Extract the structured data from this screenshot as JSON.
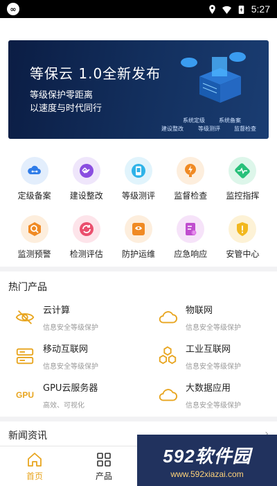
{
  "status_bar": {
    "time": "5:27"
  },
  "banner": {
    "title": "等保云 1.0全新发布",
    "subtitle_1": "等级保护零距离",
    "subtitle_2": "以速度与时代同行",
    "tags": [
      "系统定级",
      "系统备案",
      "建设整改",
      "等级测评",
      "监督检查"
    ]
  },
  "services": [
    {
      "label": "定级备案",
      "icon": "cloud-link-icon",
      "color": "#2f7ce8"
    },
    {
      "label": "建设整改",
      "icon": "link-icon",
      "color": "#8a4ee0"
    },
    {
      "label": "等级测评",
      "icon": "tablet-icon",
      "color": "#2fb3e8"
    },
    {
      "label": "监督检查",
      "icon": "lightning-icon",
      "color": "#f08a24"
    },
    {
      "label": "监控指挥",
      "icon": "pulse-icon",
      "color": "#28c07a"
    },
    {
      "label": "监测预警",
      "icon": "search-alert-icon",
      "color": "#f08a24"
    },
    {
      "label": "检测评估",
      "icon": "refresh-icon",
      "color": "#ea4f6e"
    },
    {
      "label": "防护运维",
      "icon": "shield-wall-icon",
      "color": "#f08a24"
    },
    {
      "label": "应急响应",
      "icon": "document-alert-icon",
      "color": "#c04ecf"
    },
    {
      "label": "安管中心",
      "icon": "shield-alert-icon",
      "color": "#f2b81e"
    }
  ],
  "hot_products": {
    "title": "热门产品",
    "items": [
      {
        "name": "云计算",
        "desc": "信息安全等级保护",
        "icon": "eye-off-icon"
      },
      {
        "name": "物联网",
        "desc": "信息安全等级保护",
        "icon": "cloud-icon"
      },
      {
        "name": "移动互联网",
        "desc": "信息安全等级保护",
        "icon": "server-icon"
      },
      {
        "name": "工业互联网",
        "desc": "信息安全等级保护",
        "icon": "hexagons-icon"
      },
      {
        "name": "GPU云服务器",
        "desc": "高效、可视化",
        "icon": "gpu-icon",
        "icon_text": "GPU"
      },
      {
        "name": "大数据应用",
        "desc": "信息安全等级保护",
        "icon": "cloud-icon"
      }
    ]
  },
  "news": {
    "title": "新闻资讯",
    "arrow": "›"
  },
  "tabbar": [
    {
      "label": "首页",
      "icon": "home-icon",
      "active": true
    },
    {
      "label": "产品",
      "icon": "grid-icon",
      "active": false
    }
  ],
  "watermark": {
    "main": "592软件园",
    "url": "www.592xiazai.com"
  },
  "colors": {
    "accent": "#e8a51f",
    "banner_bg": "#13305f"
  }
}
